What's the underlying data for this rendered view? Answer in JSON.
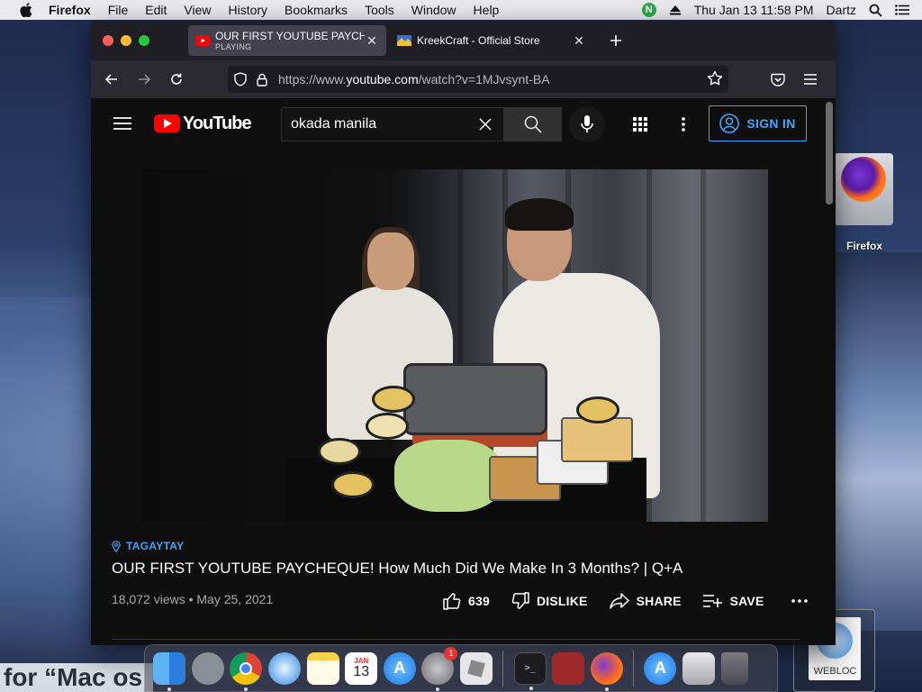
{
  "menubar": {
    "app": "Firefox",
    "items": [
      "File",
      "Edit",
      "View",
      "History",
      "Bookmarks",
      "Tools",
      "Window",
      "Help"
    ],
    "status_badge": "N",
    "clock": "Thu Jan 13  11:58 PM",
    "user": "Dartz"
  },
  "browser": {
    "tabs": [
      {
        "title": "OUR FIRST YOUTUBE PAYCHEQUE",
        "subtitle": "PLAYING",
        "active": true
      },
      {
        "title": "KreekCraft - Official Store",
        "subtitle": "",
        "active": false
      }
    ],
    "url_prefix": "https://www.",
    "url_domain": "youtube.com",
    "url_path": "/watch?v=1MJvsynt-BA"
  },
  "youtube": {
    "logo_text": "YouTube",
    "search_value": "okada manila",
    "sign_in": "SIGN IN",
    "location_tag": "TAGAYTAY",
    "video_title": "OUR FIRST YOUTUBE PAYCHEQUE! How Much Did We Make In 3 Months? | Q+A",
    "views_date": "18,072 views • May 25, 2021",
    "like_count": "639",
    "dislike": "DISLIKE",
    "share": "SHARE",
    "save": "SAVE"
  },
  "desktop": {
    "firefox_icon_label": "Firefox",
    "webloc_label": "WEBLOC",
    "bottom_text": "for “Mac os"
  },
  "dock": {
    "items": [
      "finder-icon",
      "launchpad-icon",
      "chrome-icon",
      "safari-icon",
      "notes-icon",
      "calendar-icon",
      "app-store-icon",
      "system-preferences-icon",
      "roblox-icon",
      "terminal-icon",
      "photo-booth-icon",
      "firefox-icon",
      "app-store-folder-icon",
      "preview-icon",
      "trash-icon"
    ],
    "calendar_month": "JAN",
    "calendar_day": "13",
    "prefs_badge": "1"
  },
  "colors": {
    "yt_red": "#ff0000",
    "yt_blue": "#3ea6ff",
    "ff_tab_active": "#42414d",
    "ff_toolbar": "#2b2a33"
  }
}
